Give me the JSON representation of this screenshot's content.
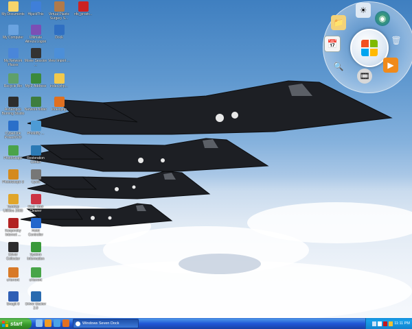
{
  "desktop": {
    "icons": [
      {
        "label": "My Documents",
        "icon": "folder-documents-icon",
        "color": "#f5d46b"
      },
      {
        "label": "HijackThis",
        "icon": "hijackthis-icon",
        "color": "#3f7fd9"
      },
      {
        "label": "Virtual Plastic Surgery S...",
        "icon": "person-icon",
        "color": "#b07a4a"
      },
      {
        "label": "nfs_prostr...",
        "icon": "game-icon",
        "color": "#c22"
      },
      {
        "label": "My Computer",
        "icon": "computer-icon",
        "color": "#6aa3e0"
      },
      {
        "label": "Ultimate Alireza Logon",
        "icon": "logon-icon",
        "color": "#7b4fb5"
      },
      {
        "label": "Dock",
        "icon": "dock-icon",
        "color": "#2f6fc2"
      },
      {
        "label": "My Network Places",
        "icon": "network-icon",
        "color": "#4a86d9"
      },
      {
        "label": "Movie Session ...",
        "icon": "movie-icon",
        "color": "#333333"
      },
      {
        "label": "View Import ...",
        "icon": "import-icon",
        "color": "#4c8fd8"
      },
      {
        "label": "Recycle Bin",
        "icon": "recycle-bin-icon",
        "color": "#5fa06a"
      },
      {
        "label": "MyIP Address",
        "icon": "globe-icon",
        "color": "#3b8a3b"
      },
      {
        "label": "index.php...",
        "icon": "folder-icon",
        "color": "#f2c94c"
      },
      {
        "label": "Ashampoo Burning Studio",
        "icon": "burn-icon",
        "color": "#2d2d2d"
      },
      {
        "label": "Network folder",
        "icon": "network-folder-icon",
        "color": "#3d7d3d"
      },
      {
        "label": "index.php",
        "icon": "firefox-icon",
        "color": "#e07020"
      },
      {
        "label": "CyberLink PowerDVD",
        "icon": "dvd-icon",
        "color": "#2a6fc9"
      },
      {
        "label": "PhotoBy ...",
        "icon": "photo-icon",
        "color": "#4d9bd5"
      },
      {
        "label": "PhotoScape",
        "icon": "photoscape-icon",
        "color": "#4aa34a"
      },
      {
        "label": "Restoration Center",
        "icon": "restore-icon",
        "color": "#2b7ab5"
      },
      {
        "label": "PhotoScape 3",
        "icon": "paint-icon",
        "color": "#d48a1e"
      },
      {
        "label": "Cycle",
        "icon": "cycle-icon",
        "color": "#777777"
      },
      {
        "label": "TuneUp Utilities 2008",
        "icon": "tuneup-icon",
        "color": "#e0a52a"
      },
      {
        "label": "Real Time Cleaner",
        "icon": "cleaner-icon",
        "color": "#cc3344"
      },
      {
        "label": "Kaspersky Internet ...",
        "icon": "kaspersky-icon",
        "color": "#b22222"
      },
      {
        "label": "Hotel Controller",
        "icon": "hotel-icon",
        "color": "#2266cc"
      },
      {
        "label": "Driver Collector",
        "icon": "traffic-light-icon",
        "color": "#2d2d2d"
      },
      {
        "label": "System Information",
        "icon": "system-info-icon",
        "color": "#3a9a3a"
      },
      {
        "label": "uTorrent",
        "icon": "torrent-icon",
        "color": "#d87a28"
      },
      {
        "label": "uTorrent",
        "icon": "utorrent-icon",
        "color": "#48a548"
      },
      {
        "label": "SnagIt 8",
        "icon": "snagit-icon",
        "color": "#2f5fb5"
      },
      {
        "label": "Driver Backer 2.0",
        "icon": "driver-backup-icon",
        "color": "#2a6bb0"
      }
    ]
  },
  "dock": {
    "center_icon": "windows-logo-icon",
    "items": [
      "weather-icon",
      "paint-icon",
      "globe-icon",
      "folder-icon",
      "recycle-bin-icon",
      "calendar-icon",
      "search-icon",
      "media-player-icon",
      "film-icon"
    ]
  },
  "taskbar": {
    "start_label": "start",
    "task_label": "Windows Seven Dock",
    "clock": "11:11 PM",
    "colors": {
      "start": "#3c9a3c",
      "bar": "#2157d7",
      "tray": "#1283cf"
    }
  }
}
